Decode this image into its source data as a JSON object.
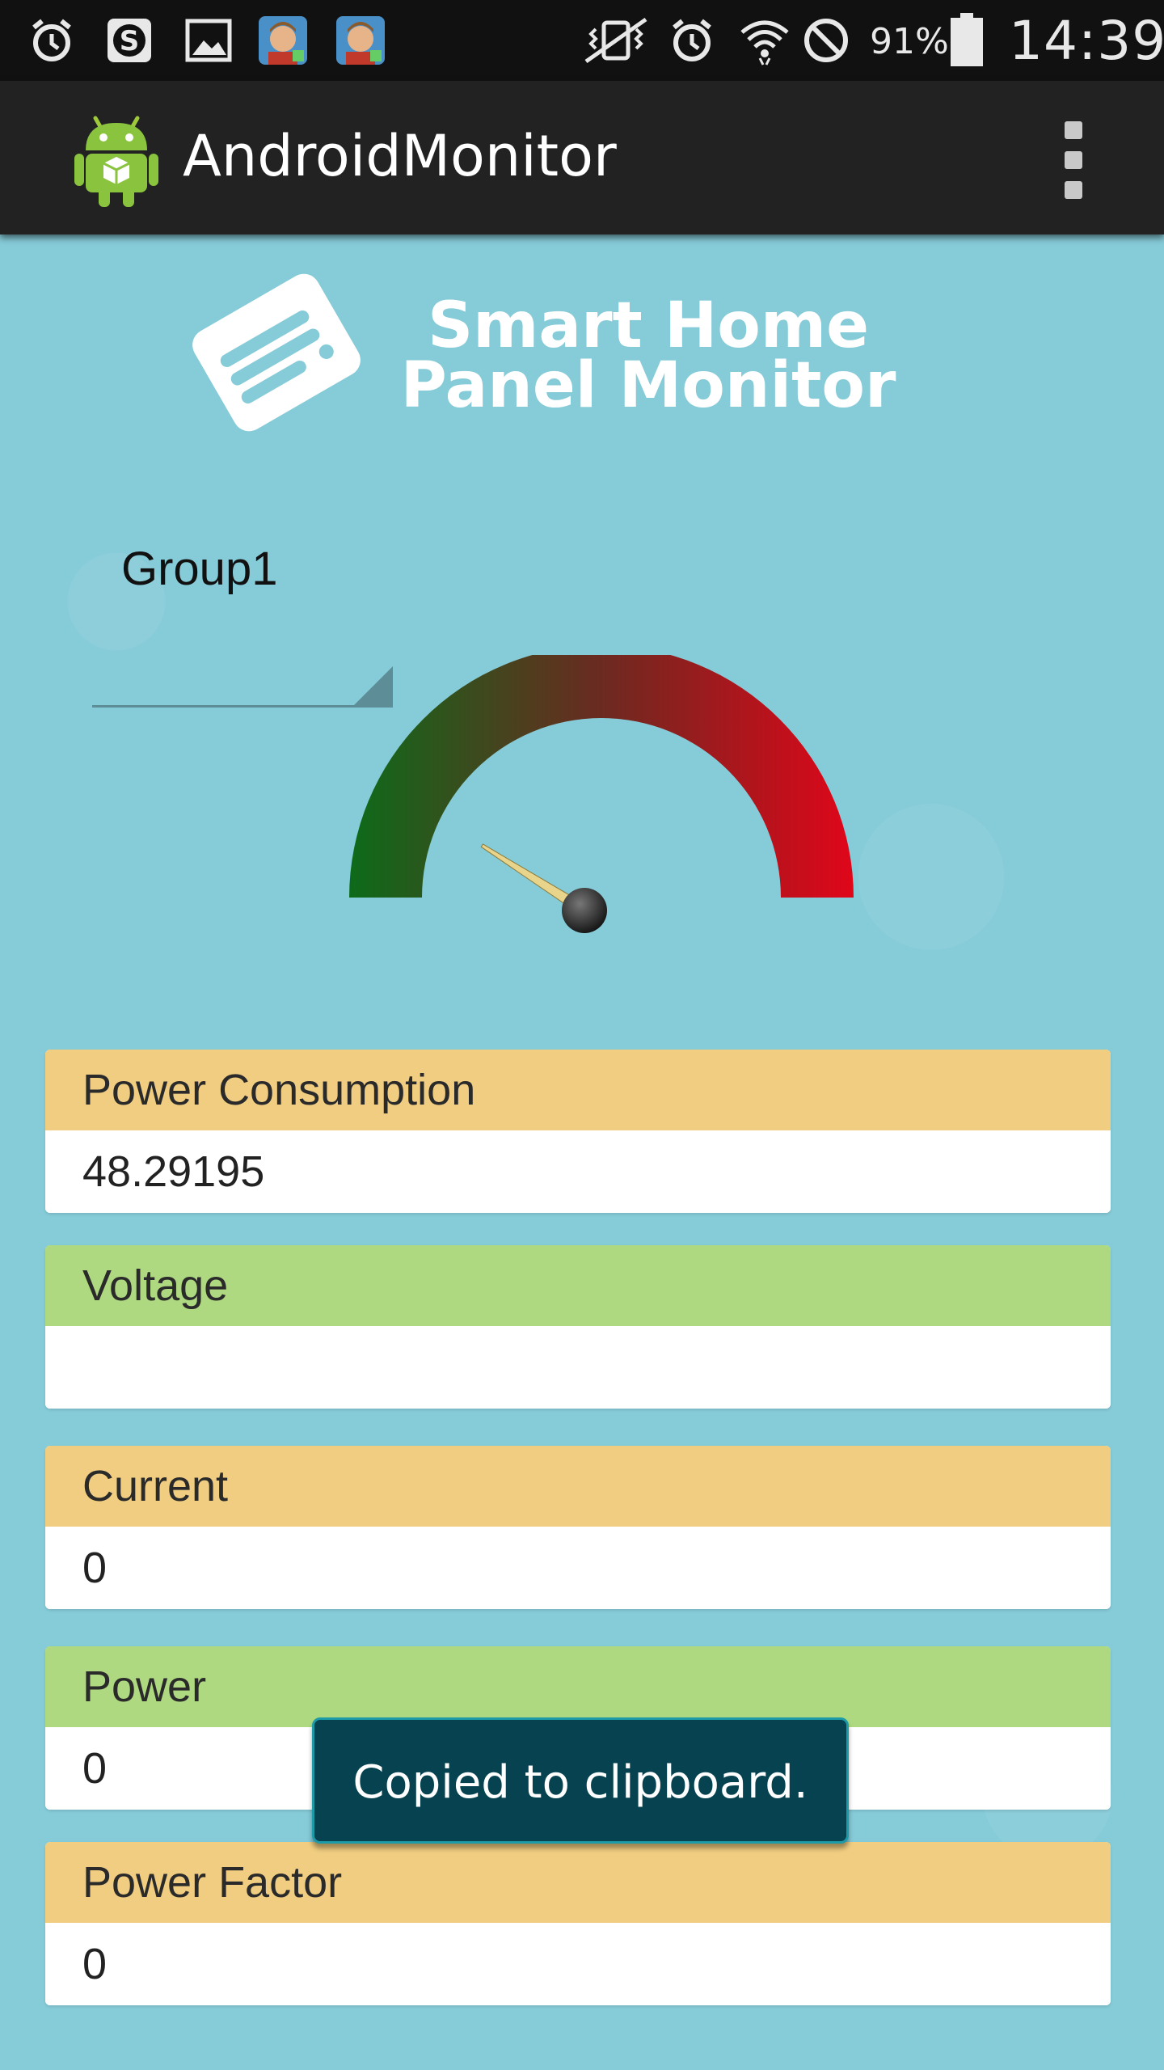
{
  "status_bar": {
    "icons": [
      "alarm-icon",
      "s-app-icon",
      "gallery-icon",
      "game-avatar-icon",
      "game-avatar-icon",
      "vibrate-icon",
      "alarm-icon",
      "wifi-icon",
      "blocked-icon",
      "battery-icon"
    ],
    "battery_percent": "91%",
    "time": "14:39"
  },
  "app_bar": {
    "title": "AndroidMonitor",
    "icon": "android-robot-icon",
    "menu_icon": "overflow-menu-icon"
  },
  "banner": {
    "line1": "Smart Home",
    "line2": "Panel Monitor"
  },
  "group_selector": {
    "selected": "Group1"
  },
  "gauge": {
    "needle_value": 0.18,
    "colors": {
      "low": "#0d6b1a",
      "mid": "#6b2a20",
      "high": "#e0061a"
    }
  },
  "cards": [
    {
      "label": "Power Consumption",
      "value": "48.29195",
      "header_color": "#f0cd80"
    },
    {
      "label": "Voltage",
      "value": "",
      "header_color": "#aed980"
    },
    {
      "label": "Current",
      "value": "0",
      "header_color": "#f0cd80"
    },
    {
      "label": "Power",
      "value": "0",
      "header_color": "#aed980"
    },
    {
      "label": "Power Factor",
      "value": "0",
      "header_color": "#f0cd80"
    }
  ],
  "toast": {
    "message": "Copied to clipboard."
  }
}
